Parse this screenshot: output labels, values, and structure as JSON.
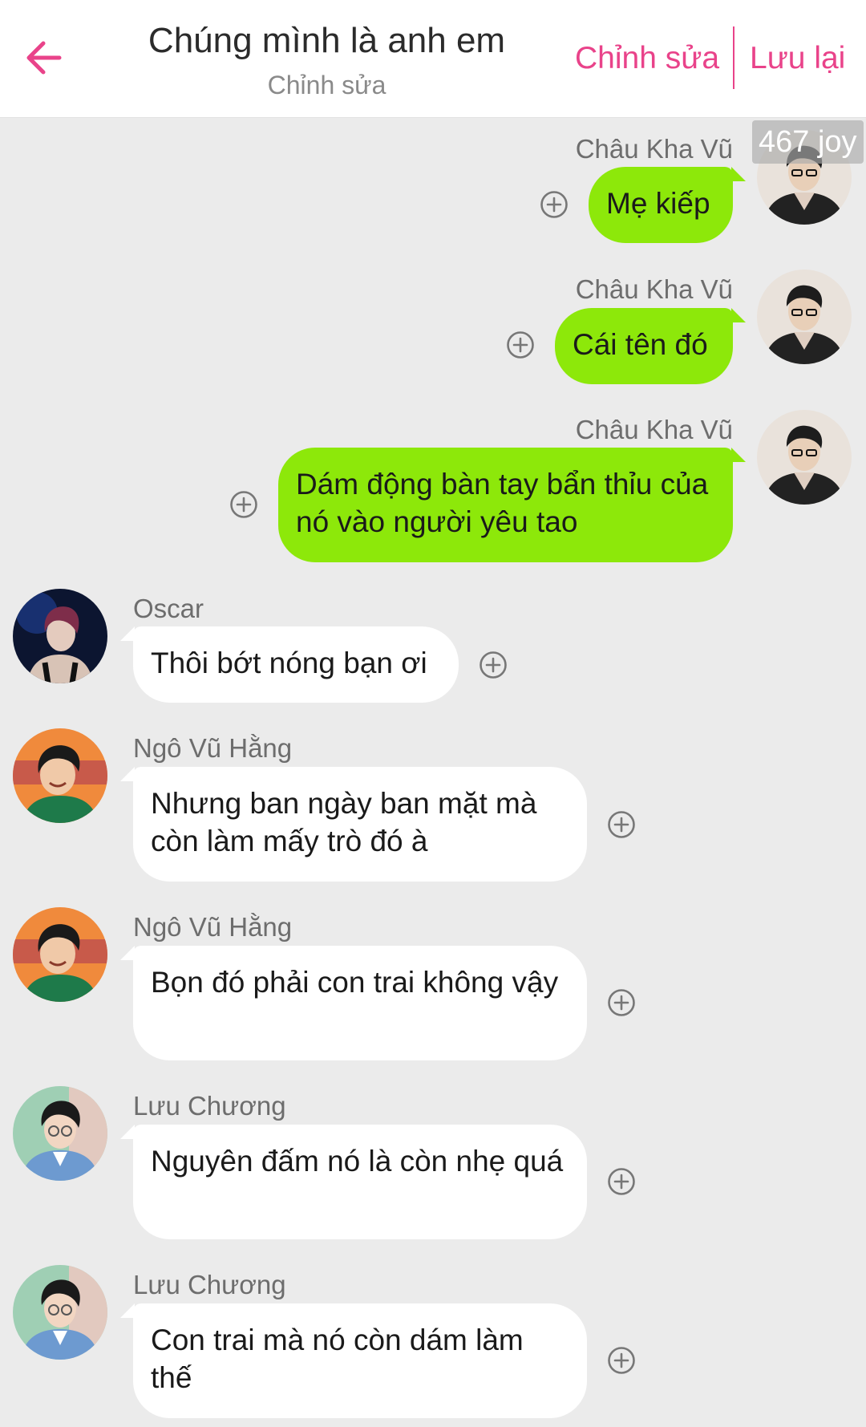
{
  "header": {
    "title": "Chúng mình là anh em",
    "subtitle": "Chỉnh sửa",
    "edit_label": "Chỉnh sửa",
    "save_label": "Lưu lại",
    "back_icon": "arrow-left-icon",
    "accent_color": "#e9438a"
  },
  "overlay_badge": "467 joy",
  "messages": [
    {
      "sender": "Châu Kha Vũ",
      "text": "Mẹ kiếp",
      "side": "right"
    },
    {
      "sender": "Châu Kha Vũ",
      "text": "Cái tên đó",
      "side": "right"
    },
    {
      "sender": "Châu Kha Vũ",
      "text": "Dám động bàn tay bẩn thỉu của nó vào người yêu tao",
      "side": "right"
    },
    {
      "sender": "Oscar",
      "text": "Thôi bớt nóng bạn ơi",
      "side": "left"
    },
    {
      "sender": "Ngô Vũ Hằng",
      "text": "Nhưng ban ngày ban mặt mà còn làm mấy trò đó à",
      "side": "left"
    },
    {
      "sender": "Ngô Vũ Hằng",
      "text": "Bọn đó phải con trai không vậy",
      "side": "left"
    },
    {
      "sender": "Lưu Chương",
      "text": "Nguyên đấm nó là còn nhẹ quá",
      "side": "left"
    },
    {
      "sender": "Lưu Chương",
      "text": "Con trai mà nó còn dám làm thế",
      "side": "left"
    }
  ],
  "colors": {
    "outgoing_bubble": "#8de80a",
    "incoming_bubble": "#ffffff",
    "background": "#ebebeb"
  }
}
